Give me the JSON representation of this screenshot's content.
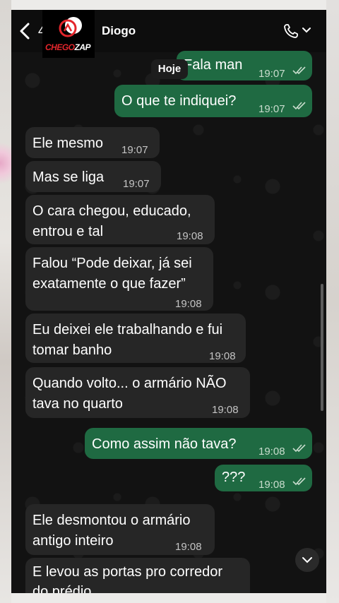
{
  "header": {
    "back_count": "4",
    "contact_name": "Diogo"
  },
  "logo": {
    "text_part1": "CHEGO",
    "text_part2": "ZAP"
  },
  "date_chip": "Hoje",
  "messages": [
    {
      "dir": "out",
      "text": "Fala man",
      "time": "19:07",
      "status": "read"
    },
    {
      "dir": "out",
      "text": "O que te indiquei?",
      "time": "19:07",
      "status": "read"
    },
    {
      "dir": "in",
      "text": "Ele mesmo",
      "time": "19:07"
    },
    {
      "dir": "in",
      "text": "Mas se liga",
      "time": "19:07"
    },
    {
      "dir": "in",
      "lines": [
        "O cara chegou, educado,",
        "entrou e tal"
      ],
      "time": "19:08"
    },
    {
      "dir": "in",
      "lines": [
        "Falou “Pode deixar, já sei",
        "exatamente o que fazer”"
      ],
      "time": "19:08"
    },
    {
      "dir": "in",
      "lines": [
        "Eu deixei ele trabalhando e fui",
        "tomar banho"
      ],
      "time": "19:08"
    },
    {
      "dir": "in",
      "lines": [
        "Quando volto... o armário NÃO",
        "tava no quarto"
      ],
      "time": "19:08"
    },
    {
      "dir": "out",
      "text": "Como assim não tava?",
      "time": "19:08",
      "status": "read"
    },
    {
      "dir": "out",
      "text": "???",
      "time": "19:08",
      "status": "read"
    },
    {
      "dir": "in",
      "lines": [
        "Ele desmontou o armário",
        "antigo inteiro"
      ],
      "time": "19:08"
    },
    {
      "dir": "in",
      "lines": [
        "E levou as portas pro corredor",
        "do prédio"
      ]
    }
  ],
  "colors": {
    "incoming_bubble": "#262626",
    "outgoing_bubble": "#1f6a42",
    "background": "#121212"
  },
  "icons": [
    "back-chevron-icon",
    "phone-icon",
    "chevron-down-icon",
    "double-check-icon",
    "scroll-down-icon"
  ]
}
